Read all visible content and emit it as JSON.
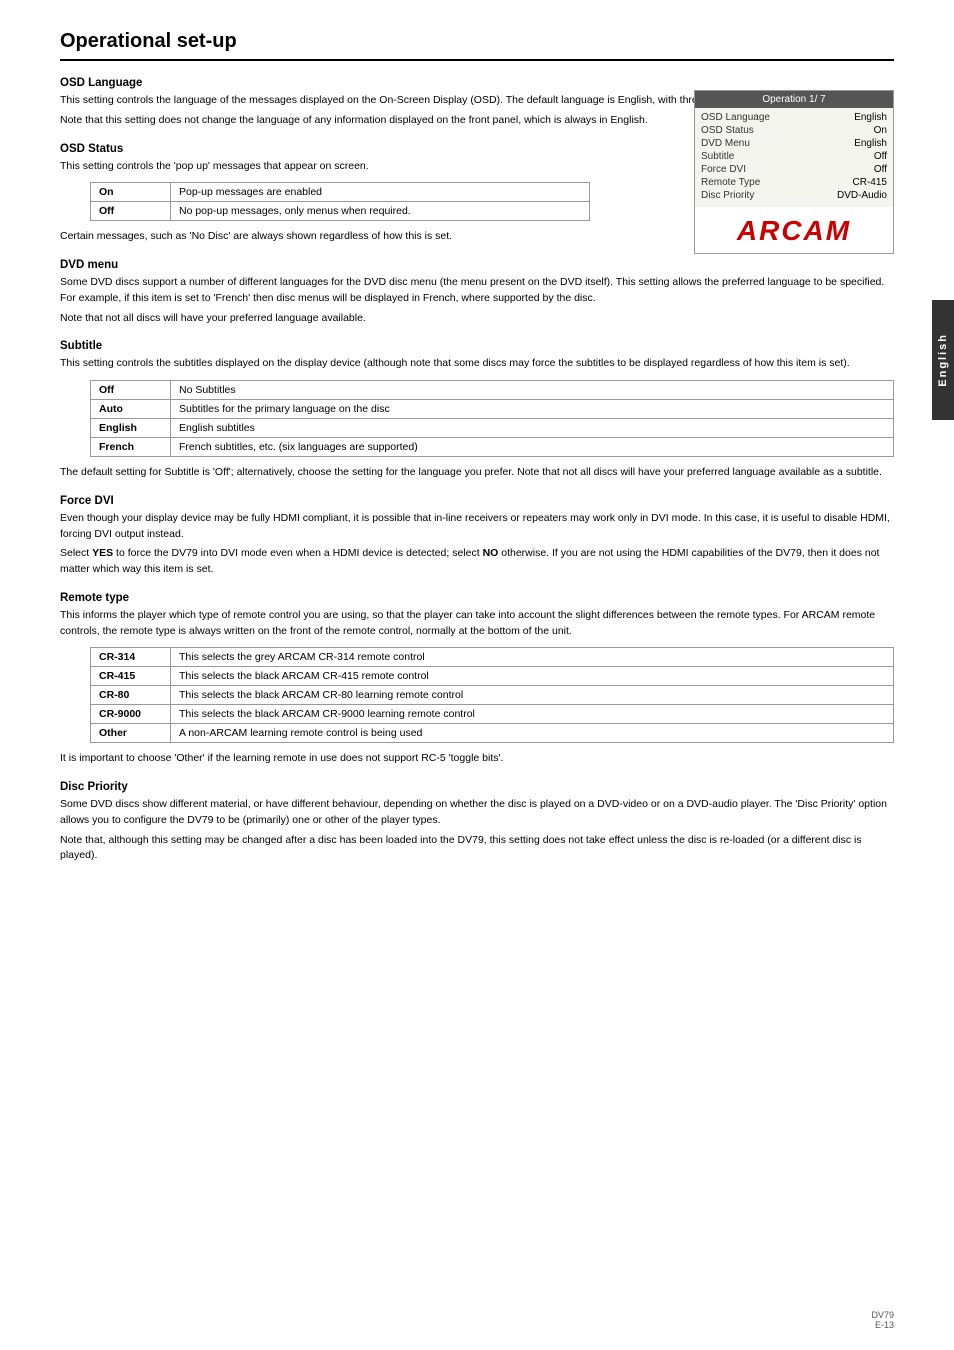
{
  "page": {
    "title": "Operational set-up",
    "side_tab": "English",
    "footer": {
      "model": "DV79",
      "page": "E-13"
    }
  },
  "info_box": {
    "header": "Operation 1/ 7",
    "rows": [
      {
        "label": "OSD Language",
        "value": "English"
      },
      {
        "label": "OSD Status",
        "value": "On"
      },
      {
        "label": "DVD Menu",
        "value": "English"
      },
      {
        "label": "Subtitle",
        "value": "Off"
      },
      {
        "label": "Force DVI",
        "value": "Off"
      },
      {
        "label": "Remote Type",
        "value": "CR-415"
      },
      {
        "label": "Disc Priority",
        "value": "DVD-Audio"
      }
    ],
    "logo": "ARCAM"
  },
  "sections": [
    {
      "id": "osd-language",
      "title": "OSD Language",
      "paragraphs": [
        "This setting controls the language of the messages displayed on the On-Screen Display (OSD). The default language is English, with three other languages supported.",
        "Note that this setting does not change the language of any information displayed on the front panel, which is always in English."
      ],
      "table": null
    },
    {
      "id": "osd-status",
      "title": "OSD Status",
      "paragraphs": [
        "This setting controls the 'pop up' messages that appear on screen."
      ],
      "table": {
        "rows": [
          {
            "col1": "On",
            "col2": "Pop-up messages are enabled"
          },
          {
            "col1": "Off",
            "col2": "No pop-up messages, only menus when required."
          }
        ]
      },
      "after_text": "Certain messages, such as 'No Disc' are always shown regardless of how this is set."
    },
    {
      "id": "dvd-menu",
      "title": "DVD menu",
      "paragraphs": [
        "Some DVD discs support a number of different languages for the DVD disc menu (the menu present on the DVD itself). This setting allows the preferred language to be specified. For example, if this item is set to 'French' then disc menus will be displayed in French, where supported by the disc.",
        "Note that not all discs will have your preferred language available."
      ],
      "table": null
    },
    {
      "id": "subtitle",
      "title": "Subtitle",
      "paragraphs": [
        "This setting controls the subtitles displayed on the display device (although note that some discs may force the subtitles to be displayed regardless of how this item is set)."
      ],
      "table": {
        "rows": [
          {
            "col1": "Off",
            "col2": "No Subtitles"
          },
          {
            "col1": "Auto",
            "col2": "Subtitles for the primary language on the disc"
          },
          {
            "col1": "English",
            "col2": "English subtitles"
          },
          {
            "col1": "French",
            "col2": "French subtitles, etc. (six languages are supported)"
          }
        ]
      },
      "after_text": "The default setting for Subtitle is 'Off'; alternatively, choose the setting for the language you prefer. Note that not all discs will have your preferred language available as a subtitle."
    },
    {
      "id": "force-dvi",
      "title": "Force DVI",
      "paragraphs": [
        "Even though your display device may be fully HDMI compliant, it is possible that in-line receivers or repeaters may work only in DVI mode. In this case, it is useful to disable HDMI, forcing DVI output instead.",
        "Select YES to force the DV79 into DVI mode even when a HDMI device is detected; select NO otherwise. If you are not using the HDMI capabilities of the DV79, then it does not matter which way this item is set."
      ],
      "table": null
    },
    {
      "id": "remote-type",
      "title": "Remote type",
      "paragraphs": [
        "This informs the player which type of remote control you are using, so that the player can take into account the slight differences between the remote types. For ARCAM remote controls, the remote type is always written on the front of the remote control, normally at the bottom of the unit."
      ],
      "table": {
        "rows": [
          {
            "col1": "CR-314",
            "col2": "This selects the grey ARCAM CR-314 remote control"
          },
          {
            "col1": "CR-415",
            "col2": "This selects the black ARCAM CR-415 remote control"
          },
          {
            "col1": "CR-80",
            "col2": "This selects the black ARCAM CR-80 learning remote control"
          },
          {
            "col1": "CR-9000",
            "col2": "This selects the black ARCAM CR-9000 learning remote control"
          },
          {
            "col1": "Other",
            "col2": "A non-ARCAM learning remote control is being used"
          }
        ]
      },
      "after_text": "It is important to choose 'Other' if the learning remote in use does not support RC-5 'toggle bits'."
    },
    {
      "id": "disc-priority",
      "title": "Disc Priority",
      "paragraphs": [
        "Some DVD discs show different material, or have different behaviour, depending on whether the disc is played on a DVD-video or on a DVD-audio player. The 'Disc Priority' option allows you to configure the DV79 to be (primarily) one or other of the player types.",
        "Note that, although this setting may be changed after a disc has been loaded into the DV79, this setting does not take effect unless the disc is re-loaded (or a different disc is played)."
      ],
      "table": null
    }
  ]
}
